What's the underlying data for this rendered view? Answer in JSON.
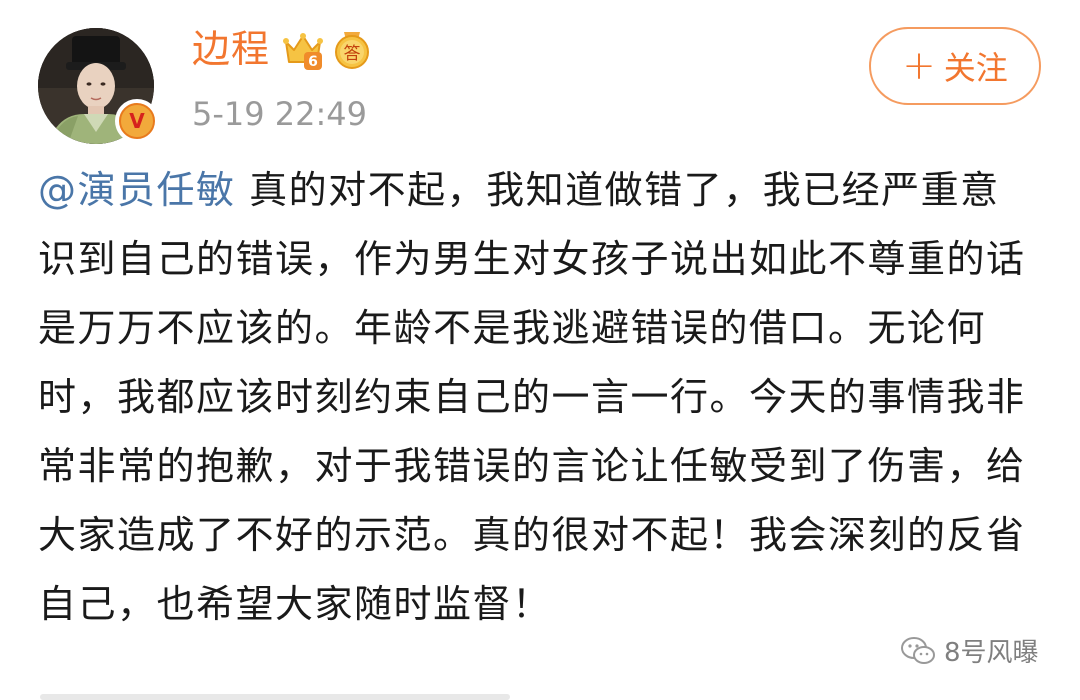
{
  "post": {
    "author": {
      "name": "边程",
      "avatar": "avatar-photo",
      "verified_badge": "V",
      "badges": [
        "crown-level-icon",
        "answer-badge-icon"
      ],
      "badge_level": "6",
      "answer_badge_text": "答"
    },
    "timestamp": "5-19 22:49",
    "follow_button": {
      "plus": "+",
      "label": "关注"
    },
    "content": {
      "mention": "@演员任敏",
      "text": " 真的对不起，我知道做错了，我已经严重意识到自己的错误，作为男生对女孩子说出如此不尊重的话是万万不应该的。年龄不是我逃避错误的借口。无论何时，我都应该时刻约束自己的一言一行。今天的事情我非常非常的抱歉，对于我错误的言论让任敏受到了伤害，给大家造成了不好的示范。真的很对不起！我会深刻的反省自己，也希望大家随时监督！"
    }
  },
  "watermark": {
    "text": "8号风曝",
    "icon": "wechat-icon"
  },
  "colors": {
    "username": "#f2762f",
    "mention": "#4a76a8",
    "timestamp": "#9a9a9a",
    "follow_border": "#f59b5f",
    "body_text": "#1a1a1a"
  }
}
